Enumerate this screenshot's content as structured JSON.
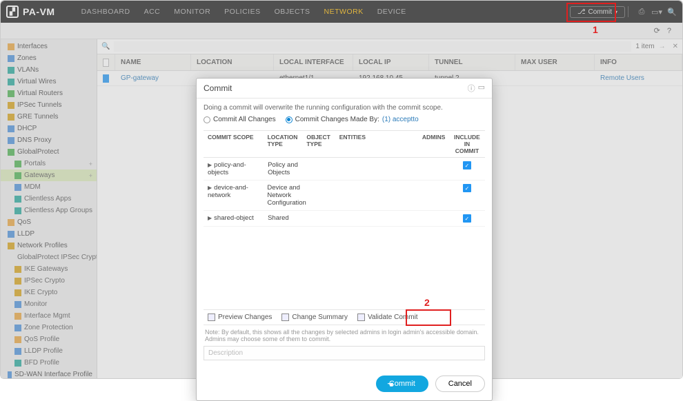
{
  "brand": "PA-VM",
  "nav": [
    "DASHBOARD",
    "ACC",
    "MONITOR",
    "POLICIES",
    "OBJECTS",
    "NETWORK",
    "DEVICE"
  ],
  "nav_active": "NETWORK",
  "commit_top_label": "Commit",
  "item_count": "1 item",
  "grid": {
    "headers": [
      "NAME",
      "LOCATION",
      "LOCAL INTERFACE",
      "LOCAL IP",
      "TUNNEL",
      "MAX USER",
      "INFO"
    ],
    "row": {
      "name": "GP-gateway",
      "location": "",
      "iface": "ethernet1/1",
      "ip": "192.168.10.45",
      "tunnel": "tunnel.2",
      "maxuser": "",
      "info": "Remote Users"
    }
  },
  "sidebar": {
    "items": [
      {
        "label": "Interfaces",
        "cls": "ico-orange"
      },
      {
        "label": "Zones",
        "cls": "ico-blue"
      },
      {
        "label": "VLANs",
        "cls": "ico-teal"
      },
      {
        "label": "Virtual Wires",
        "cls": "ico-teal"
      },
      {
        "label": "Virtual Routers",
        "cls": "ico-green"
      },
      {
        "label": "IPSec Tunnels",
        "cls": "ico-gold"
      },
      {
        "label": "GRE Tunnels",
        "cls": "ico-gold"
      },
      {
        "label": "DHCP",
        "cls": "ico-blue"
      },
      {
        "label": "DNS Proxy",
        "cls": "ico-blue"
      }
    ],
    "gp": {
      "label": "GlobalProtect",
      "children": [
        {
          "label": "Portals",
          "plus": true
        },
        {
          "label": "Gateways",
          "active": true,
          "plus": true
        },
        {
          "label": "MDM"
        },
        {
          "label": "Clientless Apps"
        },
        {
          "label": "Clientless App Groups"
        }
      ]
    },
    "rest": [
      {
        "label": "QoS",
        "cls": "ico-orange"
      },
      {
        "label": "LLDP",
        "cls": "ico-blue"
      }
    ],
    "np": {
      "label": "Network Profiles",
      "children": [
        {
          "label": "GlobalProtect IPSec Crypto"
        },
        {
          "label": "IKE Gateways"
        },
        {
          "label": "IPSec Crypto"
        },
        {
          "label": "IKE Crypto"
        },
        {
          "label": "Monitor"
        },
        {
          "label": "Interface Mgmt"
        },
        {
          "label": "Zone Protection"
        },
        {
          "label": "QoS Profile"
        },
        {
          "label": "LLDP Profile"
        },
        {
          "label": "BFD Profile"
        }
      ]
    },
    "sdwan": {
      "label": "SD-WAN Interface Profile"
    }
  },
  "modal": {
    "title": "Commit",
    "intro": "Doing a commit will overwrite the running configuration with the commit scope.",
    "opt1": "Commit All Changes",
    "opt2_a": "Commit Changes Made By:",
    "opt2_b": "(1) acceptto",
    "table_headers": {
      "scope": "COMMIT SCOPE",
      "ltype": "LOCATION TYPE",
      "otype": "OBJECT TYPE",
      "ent": "ENTITIES",
      "adm": "ADMINS",
      "inc": "INCLUDE IN COMMIT"
    },
    "rows": [
      {
        "scope": "policy-and-objects",
        "ltype": "Policy and Objects"
      },
      {
        "scope": "device-and-network",
        "ltype": "Device and Network Configuration"
      },
      {
        "scope": "shared-object",
        "ltype": "Shared"
      }
    ],
    "preview": "Preview Changes",
    "summary": "Change Summary",
    "validate": "Validate Commit",
    "note": "Note: By default, this shows all the changes by selected admins in login admin's accessible domain. Admins may choose some of them to commit.",
    "desc_placeholder": "Description",
    "commit_btn": "Commit",
    "cancel_btn": "Cancel"
  },
  "annotations": {
    "one": "1",
    "two": "2"
  }
}
